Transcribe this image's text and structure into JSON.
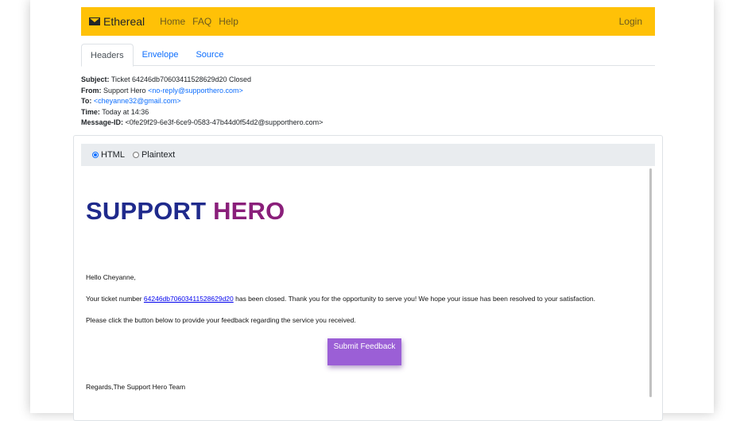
{
  "navbar": {
    "brand": "Ethereal",
    "brand_icon": "envelope-icon",
    "links": [
      "Home",
      "FAQ",
      "Help"
    ],
    "login": "Login",
    "color": "#ffc107"
  },
  "tabs": [
    "Headers",
    "Envelope",
    "Source"
  ],
  "headers": {
    "subject_label": "Subject:",
    "subject": "Ticket 64246db70603411528629d20 Closed",
    "from_label": "From:",
    "from_name": "Support Hero",
    "from_email": "<no-reply@supporthero.com>",
    "to_label": "To:",
    "to_email": "<cheyanne32@gmail.com>",
    "time_label": "Time:",
    "time": "Today at 14:36",
    "msgid_label": "Message-ID:",
    "msgid": "<0fe29f29-6e3f-6ce9-0583-47b44d0f54d2@supporthero.com>"
  },
  "format": {
    "html": "HTML",
    "plaintext": "Plaintext",
    "selected": "HTML"
  },
  "email": {
    "logo_part1": "SUPPORT",
    "logo_part2": "HERO",
    "greeting": "Hello Cheyanne,",
    "para1_before": "Your ticket number ",
    "ticket_link": "64246db70603411528629d20",
    "para1_after": " has been closed. Thank you for the opportunity to serve you! We hope your issue has been resolved to your satisfaction.",
    "para2": "Please click the button below to provide your feedback regarding the service you received.",
    "button": "Submit Feedback",
    "regards": "Regards,The Support Hero Team",
    "button_color": "#9b5fd6"
  }
}
